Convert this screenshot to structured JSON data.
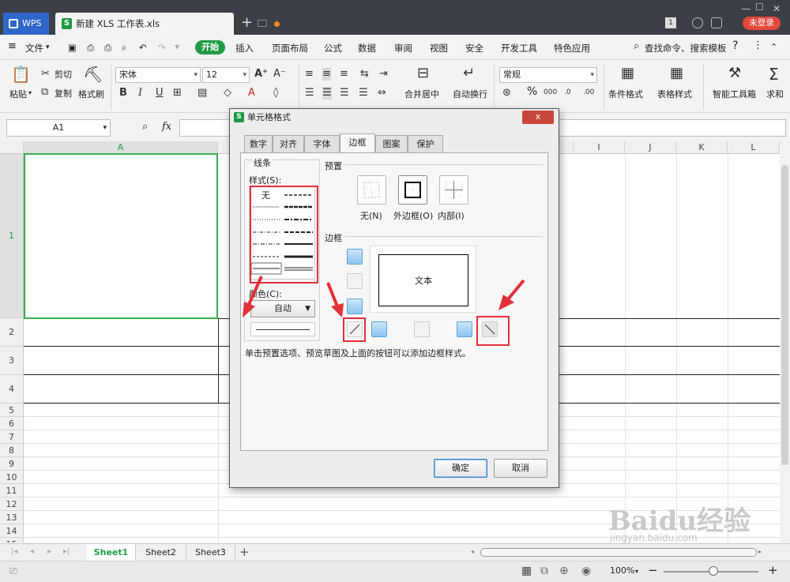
{
  "titlebar": {
    "wps_label": "WPS",
    "doc_tab_label": "新建 XLS 工作表.xls",
    "new_tab": "+",
    "badge": "1",
    "login": "未登录"
  },
  "menubar": {
    "file": "文件",
    "start": "开始",
    "items": [
      "插入",
      "页面布局",
      "公式",
      "数据",
      "审阅",
      "视图",
      "安全",
      "开发工具",
      "特色应用"
    ],
    "search": "查找命令、搜索模板",
    "help": "?"
  },
  "ribbon": {
    "paste": "粘贴",
    "cut": "剪切",
    "copy": "复制",
    "format_painter": "格式刷",
    "font_name": "宋体",
    "font_size": "12",
    "merge_center": "合并居中",
    "wrap_text": "自动换行",
    "number_format": "常规",
    "percent": "%",
    "conditional_format": "条件格式",
    "table_style": "表格样式",
    "smart_toolbox": "智能工具箱",
    "sum": "求和"
  },
  "formula": {
    "name_box": "A1",
    "fx": "fx"
  },
  "sheet": {
    "columns": [
      "A",
      "I",
      "J",
      "K",
      "L"
    ],
    "rows": [
      "1",
      "2",
      "3",
      "4",
      "5",
      "6",
      "7",
      "8",
      "9",
      "10",
      "11",
      "12",
      "13",
      "14",
      "15"
    ]
  },
  "sheet_tabs": [
    "Sheet1",
    "Sheet2",
    "Sheet3"
  ],
  "status": {
    "zoom": "100%"
  },
  "dialog": {
    "title": "单元格格式",
    "close": "x",
    "tabs": [
      "数字",
      "对齐",
      "字体",
      "边框",
      "图案",
      "保护"
    ],
    "active_tab": "边框",
    "line_group": "线条",
    "style_label": "样式(S):",
    "style_none": "无",
    "color_label": "颜色(C):",
    "color_value": "自动",
    "preset_group": "预置",
    "preset_none": "无(N)",
    "preset_outline": "外边框(O)",
    "preset_inside": "内部(I)",
    "border_group": "边框",
    "preview_text": "文本",
    "hint": "单击预置选项、预览草图及上面的按钮可以添加边框样式。",
    "ok": "确定",
    "cancel": "取消"
  },
  "watermark": {
    "brand": "Baidu经验",
    "url": "jingyan.baidu.com"
  },
  "colors": {
    "accent_green": "#1e9b44",
    "title_bg": "#3c3f46",
    "annotation_red": "#e3303a",
    "close_red": "#c9473a"
  }
}
